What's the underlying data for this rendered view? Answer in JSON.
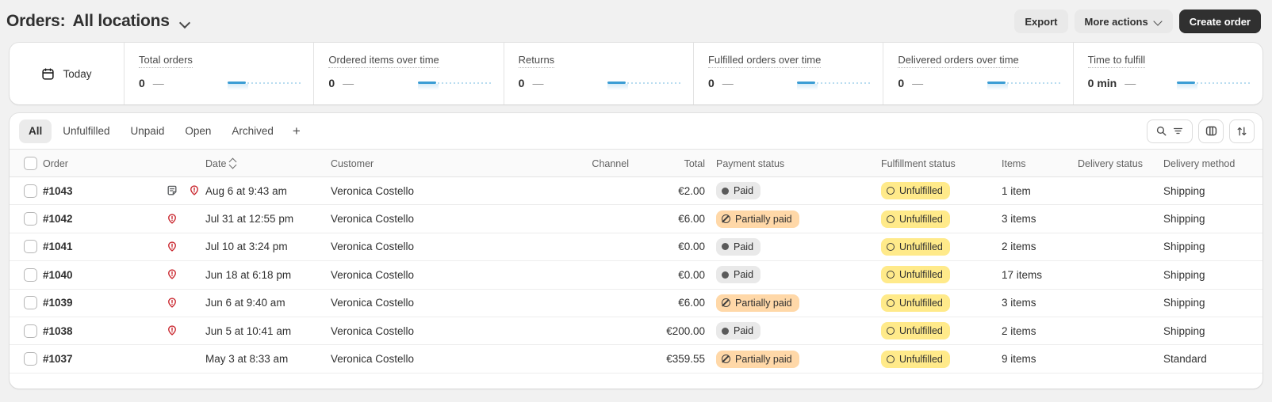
{
  "header": {
    "title_prefix": "Orders:",
    "title_scope": "All locations",
    "location_chevron_icon": "chevron-down-icon",
    "export_label": "Export",
    "more_actions_label": "More actions",
    "create_order_label": "Create order"
  },
  "metrics": {
    "today_label": "Today",
    "calendar_icon": "calendar-icon",
    "cards": [
      {
        "label": "Total orders",
        "value": "0",
        "delta": "—"
      },
      {
        "label": "Ordered items over time",
        "value": "0",
        "delta": "—"
      },
      {
        "label": "Returns",
        "value": "0",
        "delta": "—"
      },
      {
        "label": "Fulfilled orders over time",
        "value": "0",
        "delta": "—"
      },
      {
        "label": "Delivered orders over time",
        "value": "0",
        "delta": "—"
      },
      {
        "label": "Time to fulfill",
        "value": "0 min",
        "delta": "—"
      }
    ]
  },
  "tabs": {
    "items": [
      {
        "label": "All",
        "active": true
      },
      {
        "label": "Unfulfilled",
        "active": false
      },
      {
        "label": "Unpaid",
        "active": false
      },
      {
        "label": "Open",
        "active": false
      },
      {
        "label": "Archived",
        "active": false
      }
    ],
    "add_label": "+",
    "tools": {
      "search_icon": "search-icon",
      "filter_icon": "filter-icon",
      "columns_icon": "columns-icon",
      "sort_icon": "sort-arrows-icon"
    }
  },
  "table": {
    "columns": [
      "Order",
      "Date",
      "Customer",
      "Channel",
      "Total",
      "Payment status",
      "Fulfillment status",
      "Items",
      "Delivery status",
      "Delivery method"
    ],
    "sorted_column": "Date",
    "rows": [
      {
        "order": "#1043",
        "has_note": true,
        "has_risk": true,
        "date": "Aug 6 at 9:43 am",
        "customer": "Veronica Costello",
        "channel": "",
        "total": "€2.00",
        "payment_status": "Paid",
        "payment_kind": "paid",
        "fulfillment_status": "Unfulfilled",
        "items": "1 item",
        "delivery_status": "",
        "delivery_method": "Shipping"
      },
      {
        "order": "#1042",
        "has_note": false,
        "has_risk": true,
        "date": "Jul 31 at 12:55 pm",
        "customer": "Veronica Costello",
        "channel": "",
        "total": "€6.00",
        "payment_status": "Partially paid",
        "payment_kind": "partial",
        "fulfillment_status": "Unfulfilled",
        "items": "3 items",
        "delivery_status": "",
        "delivery_method": "Shipping"
      },
      {
        "order": "#1041",
        "has_note": false,
        "has_risk": true,
        "date": "Jul 10 at 3:24 pm",
        "customer": "Veronica Costello",
        "channel": "",
        "total": "€0.00",
        "payment_status": "Paid",
        "payment_kind": "paid",
        "fulfillment_status": "Unfulfilled",
        "items": "2 items",
        "delivery_status": "",
        "delivery_method": "Shipping"
      },
      {
        "order": "#1040",
        "has_note": false,
        "has_risk": true,
        "date": "Jun 18 at 6:18 pm",
        "customer": "Veronica Costello",
        "channel": "",
        "total": "€0.00",
        "payment_status": "Paid",
        "payment_kind": "paid",
        "fulfillment_status": "Unfulfilled",
        "items": "17 items",
        "delivery_status": "",
        "delivery_method": "Shipping"
      },
      {
        "order": "#1039",
        "has_note": false,
        "has_risk": true,
        "date": "Jun 6 at 9:40 am",
        "customer": "Veronica Costello",
        "channel": "",
        "total": "€6.00",
        "payment_status": "Partially paid",
        "payment_kind": "partial",
        "fulfillment_status": "Unfulfilled",
        "items": "3 items",
        "delivery_status": "",
        "delivery_method": "Shipping"
      },
      {
        "order": "#1038",
        "has_note": false,
        "has_risk": true,
        "date": "Jun 5 at 10:41 am",
        "customer": "Veronica Costello",
        "channel": "",
        "total": "€200.00",
        "payment_status": "Paid",
        "payment_kind": "paid",
        "fulfillment_status": "Unfulfilled",
        "items": "2 items",
        "delivery_status": "",
        "delivery_method": "Shipping"
      },
      {
        "order": "#1037",
        "has_note": false,
        "has_risk": false,
        "date": "May 3 at 8:33 am",
        "customer": "Veronica Costello",
        "channel": "",
        "total": "€359.55",
        "payment_status": "Partially paid",
        "payment_kind": "partial",
        "fulfillment_status": "Unfulfilled",
        "items": "9 items",
        "delivery_status": "",
        "delivery_method": "Standard"
      }
    ]
  },
  "colors": {
    "accent_dark": "#303030",
    "sparkline": "#3b9dd4",
    "badge_paid_bg": "#e9e9e9",
    "badge_partial_bg": "#ffd8a8",
    "badge_unfulfilled_bg": "#ffea8a",
    "risk_icon": "#c9252d"
  }
}
